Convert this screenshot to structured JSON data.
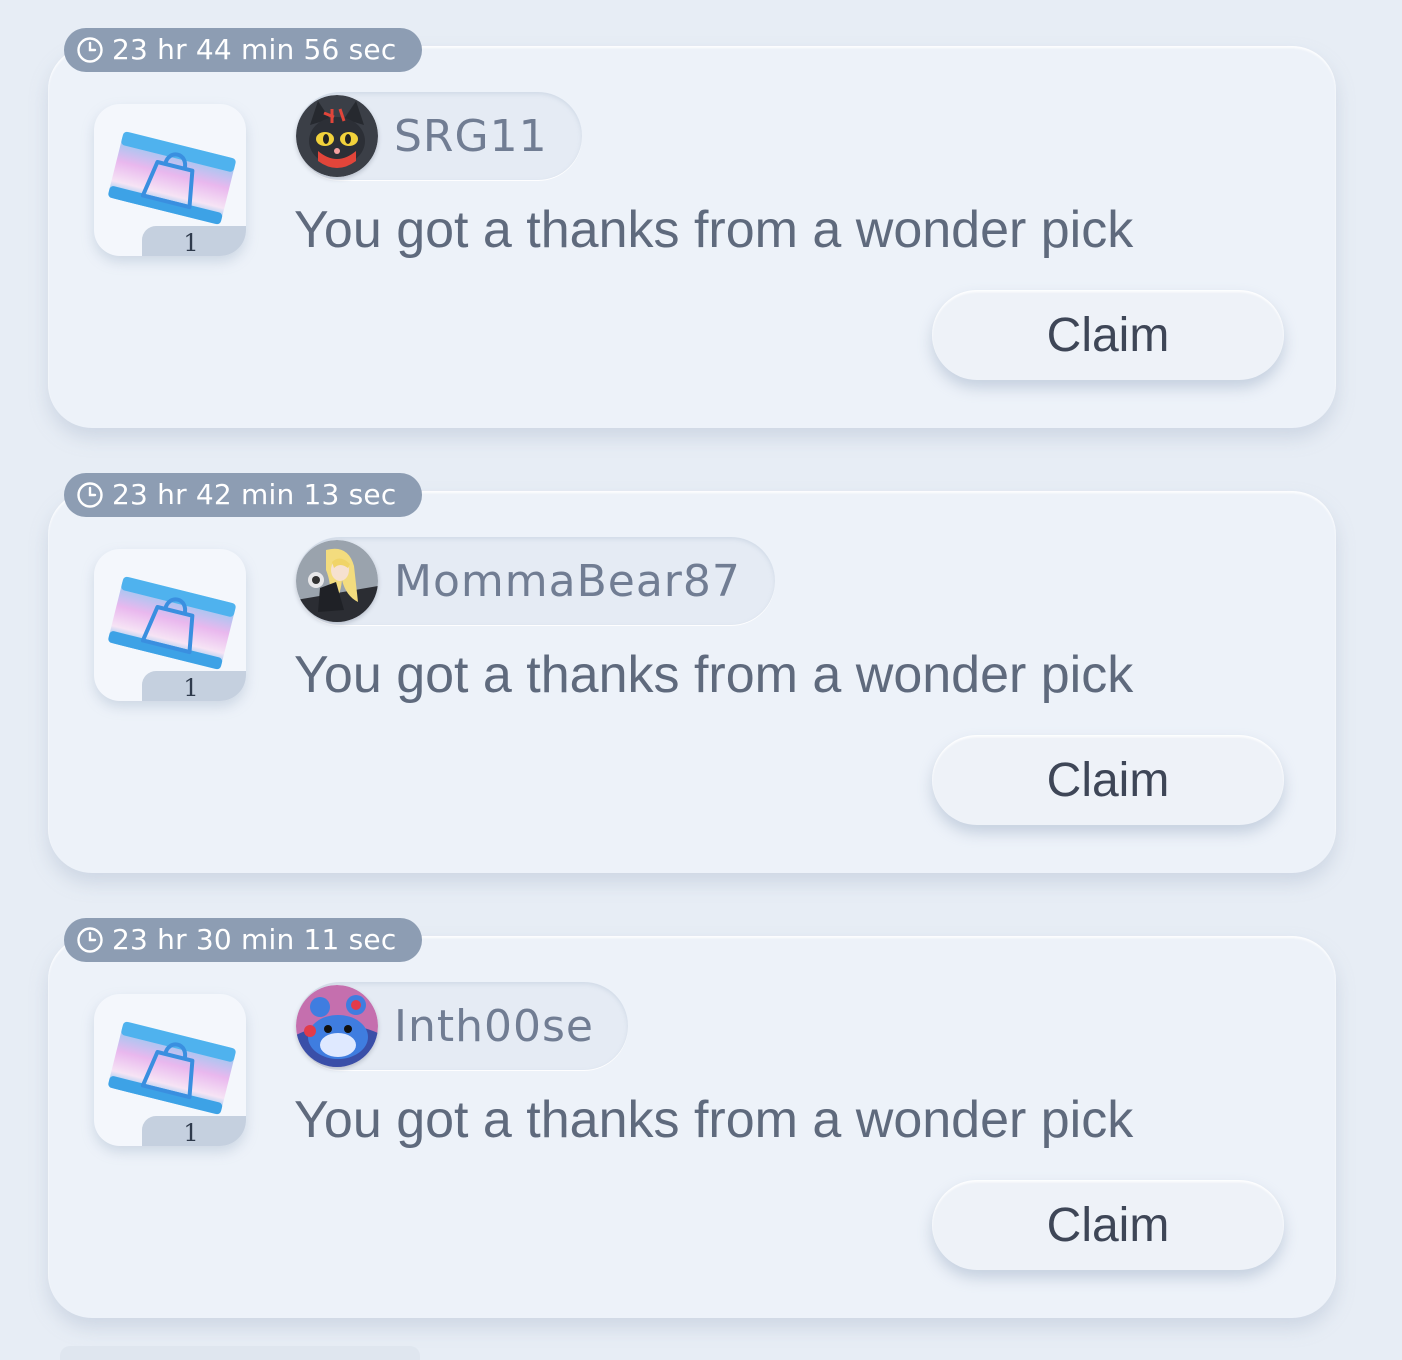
{
  "notifications": [
    {
      "timer": "23 hr 44 min 56 sec",
      "quantity": "1",
      "username": "SRG11",
      "avatar_icon": "litten-avatar-icon",
      "message": "You got a thanks from a wonder pick",
      "claim_label": "Claim"
    },
    {
      "timer": "23 hr 42 min 13 sec",
      "quantity": "1",
      "username": "MommaBear87",
      "avatar_icon": "cynthia-avatar-icon",
      "message": "You got a thanks from a wonder pick",
      "claim_label": "Claim"
    },
    {
      "timer": "23 hr 30 min 11 sec",
      "quantity": "1",
      "username": "Inth00se",
      "avatar_icon": "marill-avatar-icon",
      "message": "You got a thanks from a wonder pick",
      "claim_label": "Claim"
    }
  ],
  "colors": {
    "background": "#e7edf5",
    "timer_badge": "#8d9db3",
    "text": "#5f6a7d"
  }
}
